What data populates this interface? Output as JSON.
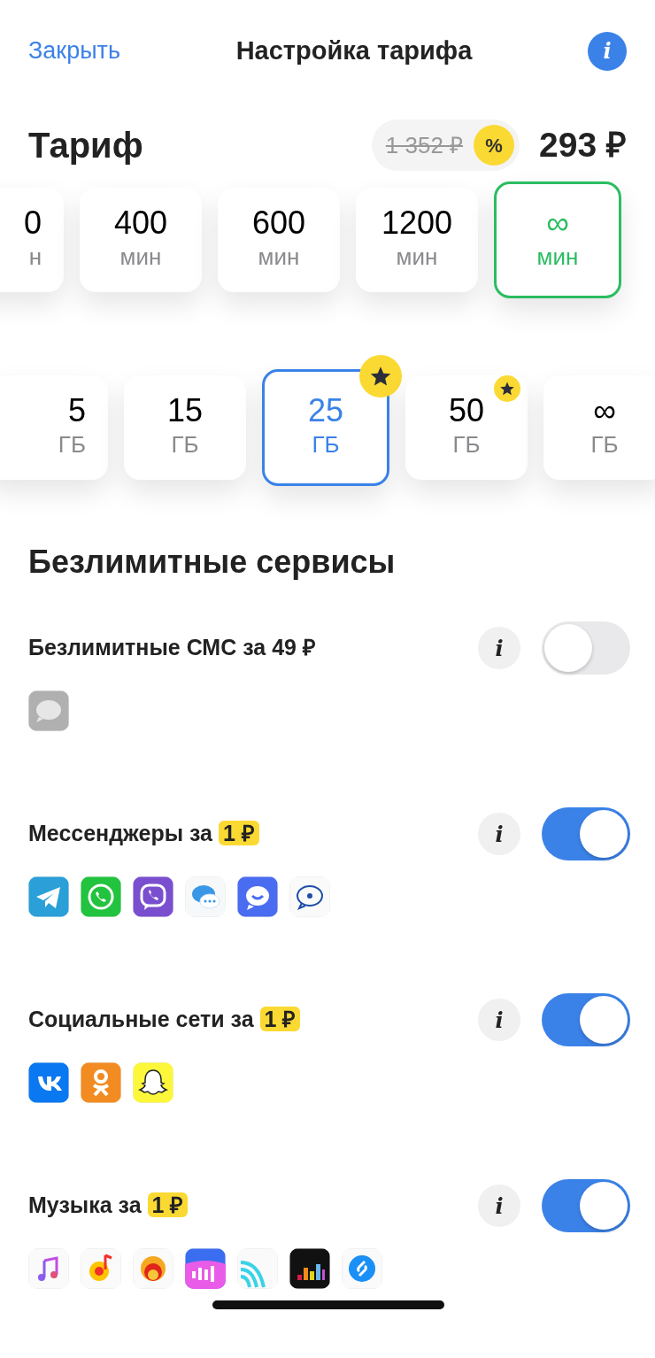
{
  "header": {
    "close": "Закрыть",
    "title": "Настройка тарифа",
    "info_icon": "i"
  },
  "tariff": {
    "label": "Тариф",
    "old_price": "1 352 ₽",
    "discount_icon": "%",
    "price": "293 ₽"
  },
  "minutes": [
    {
      "value": "0",
      "unit": "н",
      "selected": false
    },
    {
      "value": "400",
      "unit": "мин",
      "selected": false
    },
    {
      "value": "600",
      "unit": "мин",
      "selected": false
    },
    {
      "value": "1200",
      "unit": "мин",
      "selected": false
    },
    {
      "value": "∞",
      "unit": "мин",
      "selected": true
    }
  ],
  "data": [
    {
      "value": "5",
      "unit": "ГБ",
      "selected": false,
      "starred": false
    },
    {
      "value": "15",
      "unit": "ГБ",
      "selected": false,
      "starred": false
    },
    {
      "value": "25",
      "unit": "ГБ",
      "selected": true,
      "starred": true
    },
    {
      "value": "50",
      "unit": "ГБ",
      "selected": false,
      "starred": true
    },
    {
      "value": "∞",
      "unit": "ГБ",
      "selected": false,
      "starred": false
    }
  ],
  "services_heading": "Безлимитные сервисы",
  "services": [
    {
      "title": "Безлимитные СМС за",
      "price": "49 ₽",
      "price_highlighted": false,
      "info_icon": "i",
      "on": false,
      "apps": [
        {
          "kind": "grey-bubble"
        }
      ]
    },
    {
      "title": "Мессенджеры за",
      "price": "1 ₽",
      "price_highlighted": true,
      "info_icon": "i",
      "on": true,
      "apps": [
        {
          "kind": "plane"
        },
        {
          "kind": "green-phone"
        },
        {
          "kind": "purple-phone"
        },
        {
          "kind": "dots-bubble"
        },
        {
          "kind": "smile-bubble"
        },
        {
          "kind": "ring-bubble"
        }
      ]
    },
    {
      "title": "Социальные сети за",
      "price": "1 ₽",
      "price_highlighted": true,
      "info_icon": "i",
      "on": true,
      "apps": [
        {
          "kind": "blue-square"
        },
        {
          "kind": "orange-figure"
        },
        {
          "kind": "ghost"
        }
      ]
    },
    {
      "title": "Музыка за",
      "price": "1 ₽",
      "price_highlighted": true,
      "info_icon": "i",
      "on": true,
      "apps": [
        {
          "kind": "note"
        },
        {
          "kind": "red-note"
        },
        {
          "kind": "target"
        },
        {
          "kind": "bars-pink"
        },
        {
          "kind": "waves"
        },
        {
          "kind": "equalizer"
        },
        {
          "kind": "swirl"
        }
      ]
    }
  ]
}
